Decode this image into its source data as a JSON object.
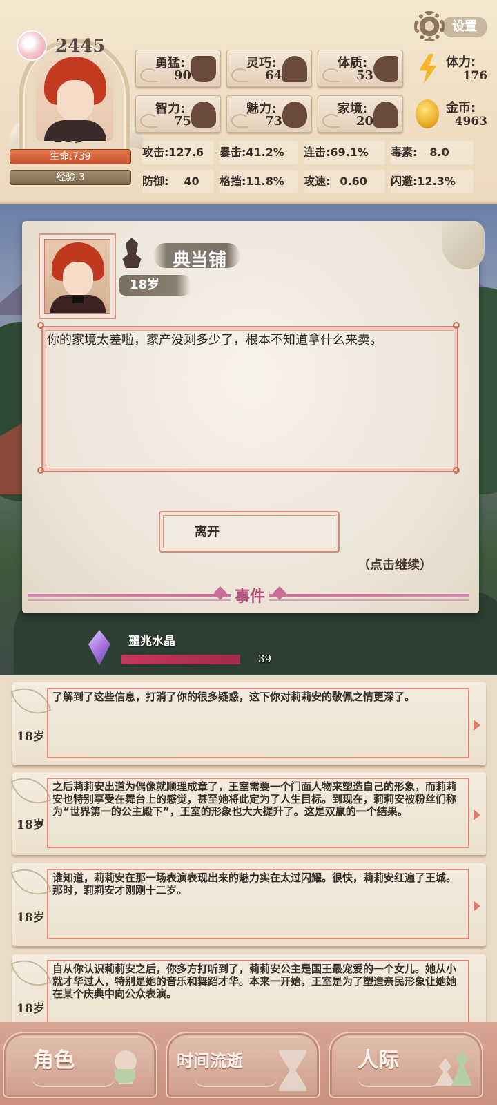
{
  "header": {
    "soul_points": "2445",
    "hero_age": "18岁",
    "hp": "生命:739",
    "xp": "经验:3",
    "settings_label": "设置",
    "attributes": [
      {
        "label": "勇猛:",
        "value": "90",
        "icon": "fist-icon"
      },
      {
        "label": "灵巧:",
        "value": "64",
        "icon": "cloak-icon"
      },
      {
        "label": "体质:",
        "value": "53",
        "icon": "muscle-arm-icon"
      },
      {
        "label": "智力:",
        "value": "75",
        "icon": "brain-icon"
      },
      {
        "label": "魅力:",
        "value": "73",
        "icon": "flower-icon"
      },
      {
        "label": "家境:",
        "value": "20",
        "icon": "house-hand-icon"
      }
    ],
    "resources": [
      {
        "label": "体力:",
        "value": "176",
        "icon": "lightning-icon"
      },
      {
        "label": "金币:",
        "value": "4963",
        "icon": "gold-coin-icon"
      }
    ],
    "combat": [
      {
        "label": "攻击:",
        "value": "127.6"
      },
      {
        "label": "暴击:",
        "value": "41.2%"
      },
      {
        "label": "连击:",
        "value": "69.1%"
      },
      {
        "label": "毒素:",
        "value": "8.0"
      },
      {
        "label": "防御:",
        "value": "40"
      },
      {
        "label": "格挡:",
        "value": "11.8%"
      },
      {
        "label": "攻速:",
        "value": "0.60"
      },
      {
        "label": "闪避:",
        "value": "12.3%"
      }
    ]
  },
  "event": {
    "title": "典当铺",
    "age": "18岁",
    "dialog": "你的家境太差啦，家产没剩多少了，根本不知道拿什么来卖。",
    "leave_button": "离开",
    "continue_hint": "（点击继续）",
    "section_label": "事件"
  },
  "crystal": {
    "label": "噩兆水晶",
    "value": "39",
    "progress_percent": 39
  },
  "log": [
    {
      "age": "18岁",
      "text": "了解到了这些信息，打消了你的很多疑惑，这下你对莉莉安的敬佩之情更深了。"
    },
    {
      "age": "18岁",
      "text": "之后莉莉安出道为偶像就顺理成章了，王室需要一个门面人物来塑造自己的形象，而莉莉安也特别享受在舞台上的感觉，甚至她将此定为了人生目标。到现在，莉莉安被粉丝们称为“世界第一的公主殿下”，王室的形象也大大提升了。这是双赢的一个结果。"
    },
    {
      "age": "18岁",
      "text": "谁知道，莉莉安在那一场表演表现出来的魅力实在太过闪耀。很快，莉莉安红遍了王城。那时，莉莉安才刚刚十二岁。"
    },
    {
      "age": "18岁",
      "text": "自从你认识莉莉安之后，你多方打听到了，莉莉安公主是国王最宠爱的一个女儿。她从小就才华过人，特别是她的音乐和舞蹈才华。本来一开始，王室是为了塑造亲民形象让她她在某个庆典中向公众表演。"
    }
  ],
  "nav": [
    {
      "label": "角色",
      "icon": "mirror-icon"
    },
    {
      "label": "时间流逝",
      "icon": "hourglass-icon"
    },
    {
      "label": "人际",
      "icon": "chess-pieces-icon"
    }
  ]
}
